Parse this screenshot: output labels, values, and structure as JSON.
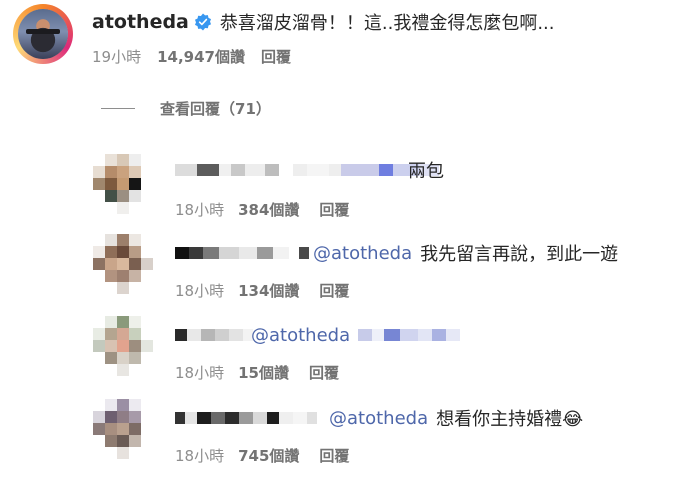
{
  "main_comment": {
    "username": "atotheda",
    "text": "恭喜溜皮溜骨！！這..我禮金得怎麼包啊...",
    "time": "19小時",
    "likes": "14,947個讚",
    "reply_label": "回覆",
    "verified_icon": "verified-badge-icon",
    "verified_color": "#3897f0"
  },
  "view_replies": {
    "label": "查看回覆（71）"
  },
  "replies": [
    {
      "mention": "",
      "text": "兩包",
      "time": "18小時",
      "likes": "384個讚",
      "reply_label": "回覆"
    },
    {
      "mention": "@atotheda",
      "text": "我先留言再說，到此一遊",
      "time": "18小時",
      "likes": "134個讚",
      "reply_label": "回覆"
    },
    {
      "mention": "@atotheda",
      "text": "",
      "time": "18小時",
      "likes": "15個讚",
      "reply_label": "回覆"
    },
    {
      "mention": "@atotheda",
      "text": "想看你主持婚禮😂",
      "time": "18小時",
      "likes": "745個讚",
      "reply_label": "回覆"
    }
  ],
  "colors": {
    "text": "#262626",
    "meta": "#8e8e8e",
    "mention": "#4e67aa"
  }
}
